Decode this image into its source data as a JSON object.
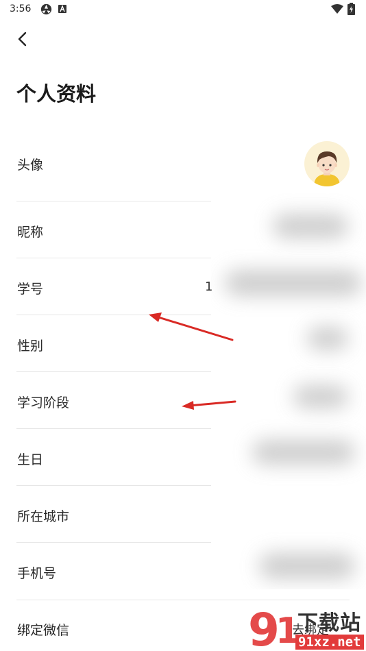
{
  "status_bar": {
    "time": "3:56"
  },
  "header": {
    "title": "个人资料"
  },
  "rows": [
    {
      "label": "头像"
    },
    {
      "label": "昵称"
    },
    {
      "label": "学号",
      "value_fragment": "1"
    },
    {
      "label": "性别"
    },
    {
      "label": "学习阶段"
    },
    {
      "label": "生日"
    },
    {
      "label": "所在城市"
    },
    {
      "label": "手机号"
    },
    {
      "label": "绑定微信",
      "action": "去绑定"
    }
  ],
  "annotation": {
    "arrow_color": "#d92a25"
  },
  "watermark": {
    "text": "下载站",
    "domain": "91xz.net",
    "logo_color": "#e23b3b"
  }
}
